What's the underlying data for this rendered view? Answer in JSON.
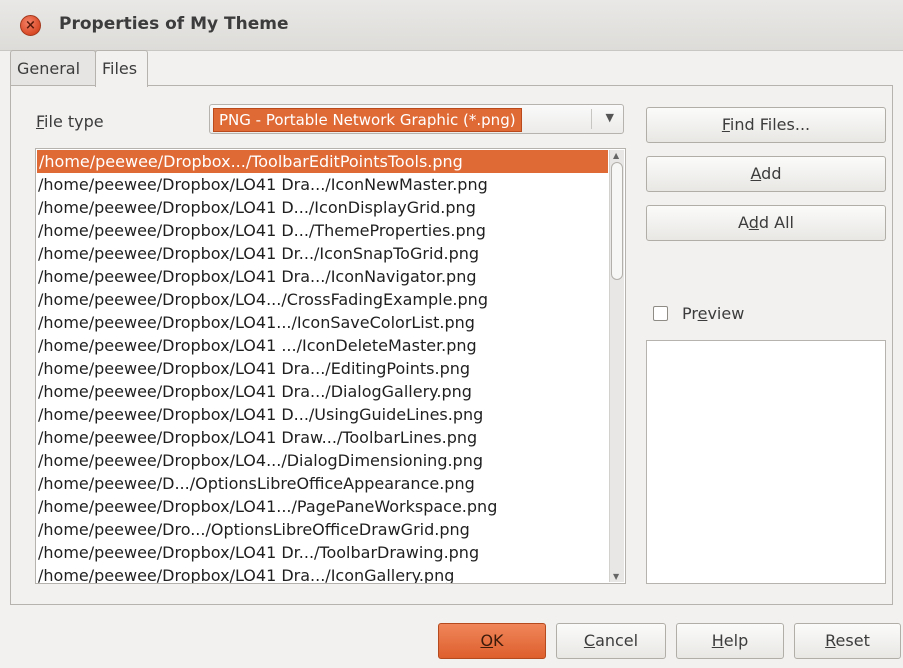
{
  "window": {
    "title": "Properties of My Theme",
    "close_glyph": "×"
  },
  "tabs": [
    {
      "label": "General"
    },
    {
      "label": "Files"
    }
  ],
  "file_type": {
    "label_mnemonic": "F",
    "label_rest": "ile type",
    "selected_value": "PNG - Portable Network Graphic (*.png)"
  },
  "file_list": [
    "/home/peewee/Dropbox.../ToolbarEditPointsTools.png",
    "/home/peewee/Dropbox/LO41 Dra.../IconNewMaster.png",
    "/home/peewee/Dropbox/LO41 D.../IconDisplayGrid.png",
    "/home/peewee/Dropbox/LO41 D.../ThemeProperties.png",
    "/home/peewee/Dropbox/LO41 Dr.../IconSnapToGrid.png",
    "/home/peewee/Dropbox/LO41 Dra.../IconNavigator.png",
    "/home/peewee/Dropbox/LO4.../CrossFadingExample.png",
    "/home/peewee/Dropbox/LO41.../IconSaveColorList.png",
    "/home/peewee/Dropbox/LO41 .../IconDeleteMaster.png",
    "/home/peewee/Dropbox/LO41 Dra.../EditingPoints.png",
    "/home/peewee/Dropbox/LO41 Dra.../DialogGallery.png",
    "/home/peewee/Dropbox/LO41 D.../UsingGuideLines.png",
    "/home/peewee/Dropbox/LO41 Draw.../ToolbarLines.png",
    "/home/peewee/Dropbox/LO4.../DialogDimensioning.png",
    "/home/peewee/D.../OptionsLibreOfficeAppearance.png",
    "/home/peewee/Dropbox/LO41.../PagePaneWorkspace.png",
    "/home/peewee/Dro.../OptionsLibreOfficeDrawGrid.png",
    "/home/peewee/Dropbox/LO41 Dr.../ToolbarDrawing.png",
    "/home/peewee/Dropbox/LO41 Dra.../IconGallery.png"
  ],
  "buttons": {
    "find_files": {
      "pre": "",
      "key": "F",
      "post": "ind Files..."
    },
    "add": {
      "pre": "",
      "key": "A",
      "post": "dd"
    },
    "add_all": {
      "pre": "A",
      "key": "d",
      "post": "d All"
    },
    "ok": {
      "pre": "",
      "key": "O",
      "post": "K"
    },
    "cancel": {
      "pre": "",
      "key": "C",
      "post": "ancel"
    },
    "help": {
      "pre": "",
      "key": "H",
      "post": "elp"
    },
    "reset": {
      "pre": "",
      "key": "R",
      "post": "eset"
    }
  },
  "preview": {
    "pre": "Pr",
    "key": "e",
    "post": "view",
    "checked": false
  },
  "colors": {
    "accent": "#e06a36",
    "window_bg": "#f2f1f0"
  }
}
